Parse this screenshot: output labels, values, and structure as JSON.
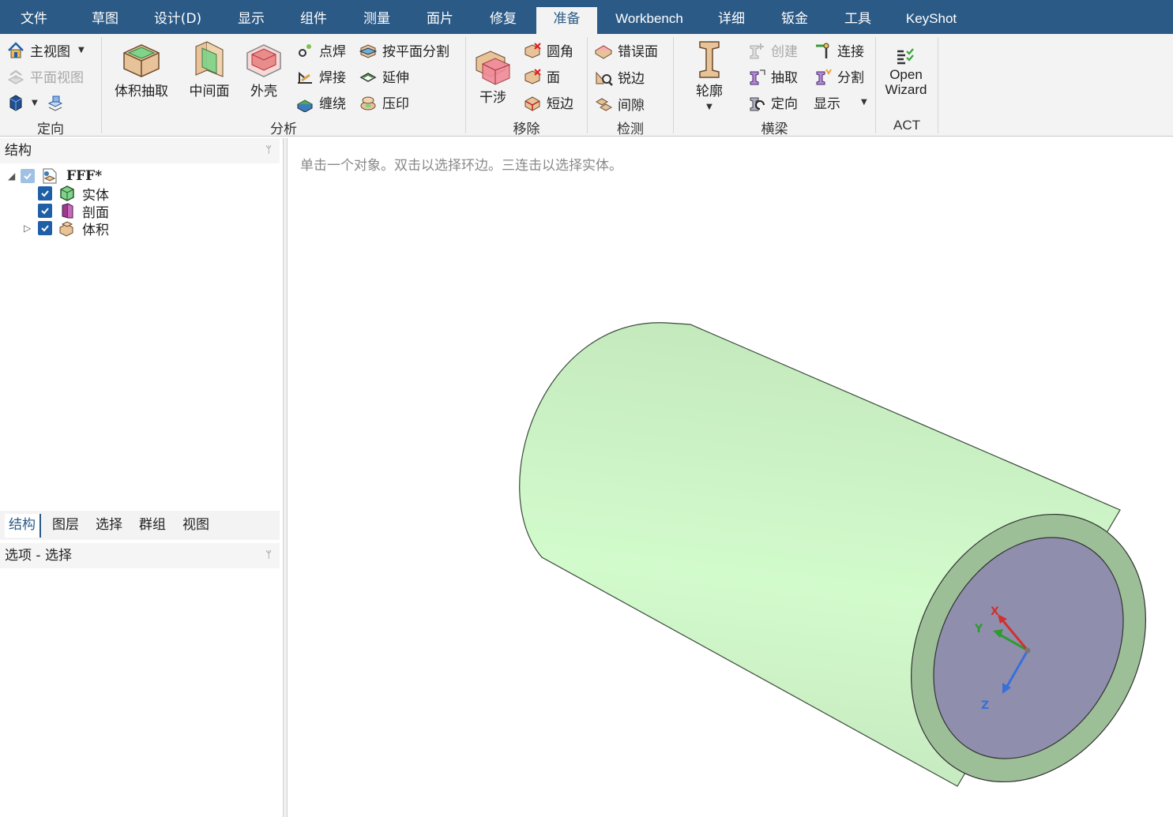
{
  "menu": {
    "tabs": [
      "文件",
      "草图",
      "设计(D)",
      "显示",
      "组件",
      "测量",
      "面片",
      "修复",
      "准备",
      "Workbench",
      "详细",
      "钣金",
      "工具",
      "KeyShot"
    ],
    "active": "准备"
  },
  "ribbon": {
    "orient": {
      "home": "主视图",
      "plan": "平面视图",
      "group": "定向"
    },
    "analyze": {
      "volume_extract": "体积抽取",
      "midsurface": "中间面",
      "shell": "外壳",
      "spot_weld": "点焊",
      "weld": "焊接",
      "wrap": "缠绕",
      "split_by_plane": "按平面分割",
      "extend": "延伸",
      "imprint": "压印",
      "group": "分析"
    },
    "remove": {
      "interference": "干涉",
      "rounds": "圆角",
      "faces": "面",
      "short_edges": "短边",
      "group": "移除"
    },
    "detect": {
      "problem_faces": "错误面",
      "sharp_edges": "锐边",
      "gaps": "间隙",
      "group": "检测"
    },
    "beams": {
      "profile": "轮廓",
      "create": "创建",
      "extract": "抽取",
      "orient": "定向",
      "connect": "连接",
      "split": "分割",
      "display": "显示",
      "group": "横梁"
    },
    "act": {
      "open": "Open",
      "wizard": "Wizard",
      "group": "ACT"
    }
  },
  "structure": {
    "title": "结构",
    "tree": [
      {
        "label": "FFF*",
        "checked": true
      },
      {
        "label": "实体",
        "checked": true
      },
      {
        "label": "剖面",
        "checked": true
      },
      {
        "label": "体积",
        "checked": true
      }
    ]
  },
  "bottom_tabs": [
    "结构",
    "图层",
    "选择",
    "群组",
    "视图"
  ],
  "options": {
    "title": "选项 - 选择"
  },
  "viewport": {
    "hint": "单击一个对象。双击以选择环边。三连击以选择实体。",
    "axes": {
      "x": "X",
      "y": "Y",
      "z": "Z"
    },
    "colors": {
      "cylinder": "#c8f2c4",
      "end_ring": "#9dbf98",
      "inner_face": "#8f8fad",
      "accent": "#2b5a86"
    }
  }
}
